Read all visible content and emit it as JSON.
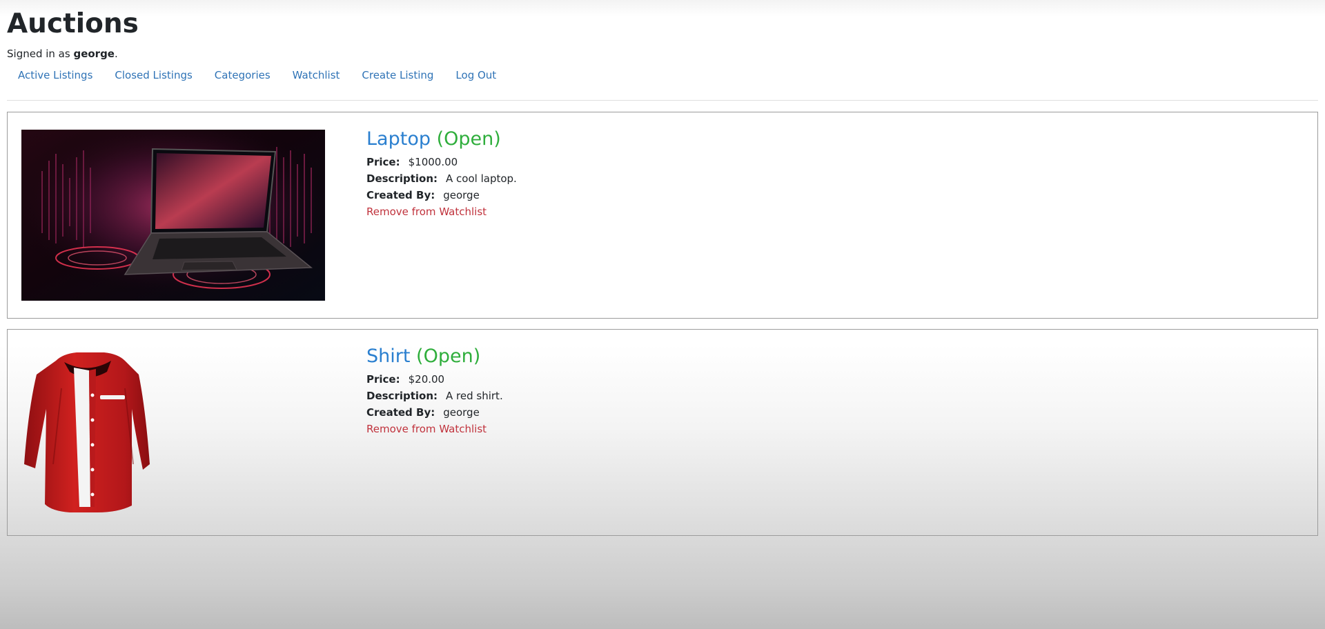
{
  "header": {
    "title": "Auctions",
    "signed_prefix": "Signed in as ",
    "username": "george",
    "signed_suffix": "."
  },
  "nav": {
    "items": [
      "Active Listings",
      "Closed Listings",
      "Categories",
      "Watchlist",
      "Create Listing",
      "Log Out"
    ]
  },
  "listings": [
    {
      "title": "Laptop",
      "status": "(Open)",
      "price_label": "Price:",
      "price": "$1000.00",
      "description_label": "Description:",
      "description": "A cool laptop.",
      "created_label": "Created By:",
      "created_by": "george",
      "watch_action": "Remove from Watchlist",
      "image_icon": "laptop-photo"
    },
    {
      "title": "Shirt",
      "status": "(Open)",
      "price_label": "Price:",
      "price": "$20.00",
      "description_label": "Description:",
      "description": "A red shirt.",
      "created_label": "Created By:",
      "created_by": "george",
      "watch_action": "Remove from Watchlist",
      "image_icon": "shirt-photo"
    }
  ],
  "colors": {
    "link": "#2f73b6",
    "title": "#2a7fcf",
    "open_status": "#2fae3c",
    "remove": "#c0323c"
  }
}
